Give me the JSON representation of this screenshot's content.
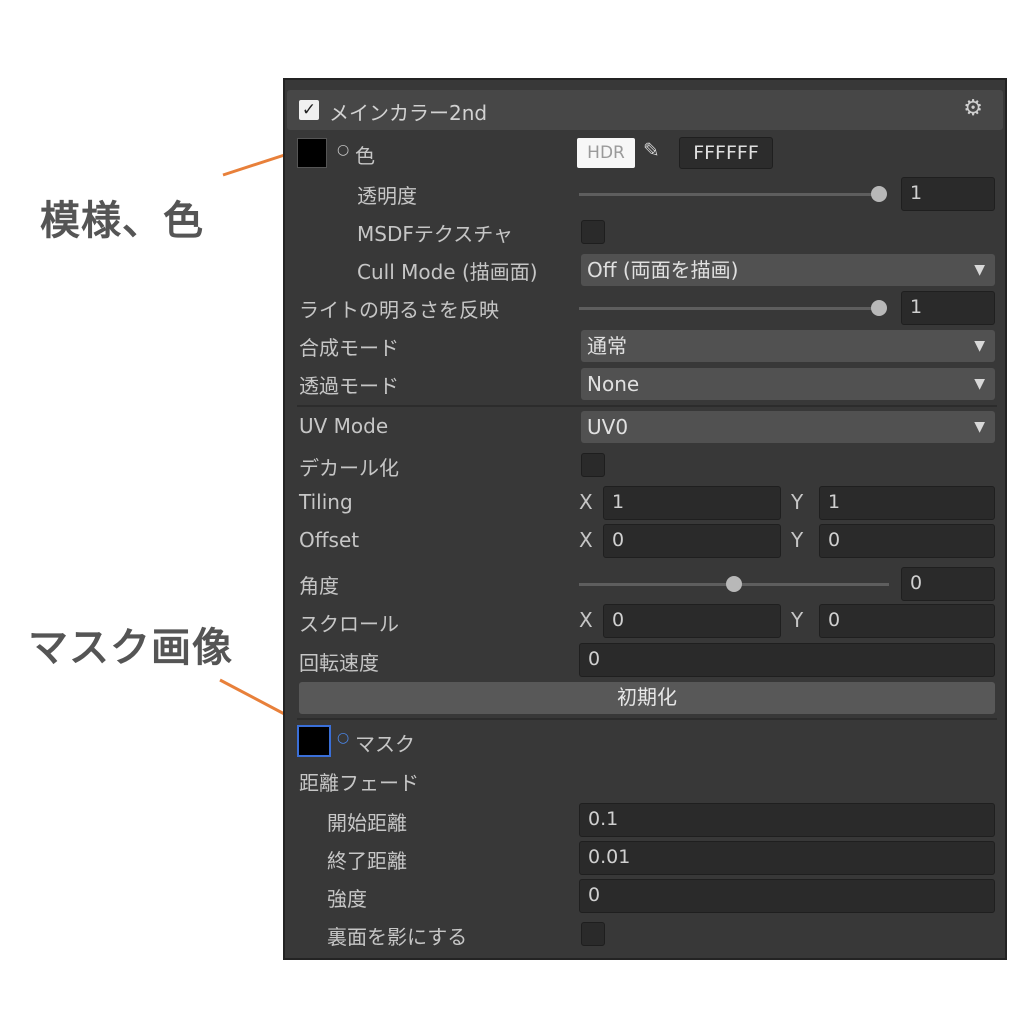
{
  "callouts": {
    "pattern_color": "模様、色",
    "mask_image": "マスク画像"
  },
  "accent_color": "#e8803a",
  "panel": {
    "header": {
      "enabled": true,
      "title": "メインカラー2nd",
      "gear_icon": "gear-icon"
    },
    "color": {
      "label": "色",
      "hdr_label": "HDR",
      "hex_value": "FFFFFF",
      "swatch_color": "#000000"
    },
    "transparency": {
      "label": "透明度",
      "value": "1",
      "level": 1.0
    },
    "msdf": {
      "label": "MSDFテクスチャ",
      "checked": false
    },
    "cull_mode": {
      "label": "Cull Mode (描画面)",
      "value": "Off (両面を描画)"
    },
    "light_reflect": {
      "label": "ライトの明るさを反映",
      "value": "1",
      "level": 1.0
    },
    "blend_mode": {
      "label": "合成モード",
      "value": "通常"
    },
    "alpha_mode": {
      "label": "透過モード",
      "value": "None"
    },
    "uv_mode": {
      "label": "UV Mode",
      "value": "UV0"
    },
    "decal": {
      "label": "デカール化",
      "checked": false
    },
    "tiling": {
      "label": "Tiling",
      "x_label": "X",
      "x": "1",
      "y_label": "Y",
      "y": "1"
    },
    "offset": {
      "label": "Offset",
      "x_label": "X",
      "x": "0",
      "y_label": "Y",
      "y": "0"
    },
    "angle": {
      "label": "角度",
      "value": "0",
      "level": 0.5
    },
    "scroll": {
      "label": "スクロール",
      "x_label": "X",
      "x": "0",
      "y_label": "Y",
      "y": "0"
    },
    "rotation_speed": {
      "label": "回転速度",
      "value": "0"
    },
    "reset_button": "初期化",
    "mask": {
      "label": "マスク",
      "swatch_color": "#000000"
    },
    "distance_fade": {
      "label": "距離フェード"
    },
    "fade_start": {
      "label": "開始距離",
      "value": "0.1"
    },
    "fade_end": {
      "label": "終了距離",
      "value": "0.01"
    },
    "strength": {
      "label": "強度",
      "value": "0"
    },
    "backface_shadow": {
      "label": "裏面を影にする",
      "checked": false
    }
  }
}
